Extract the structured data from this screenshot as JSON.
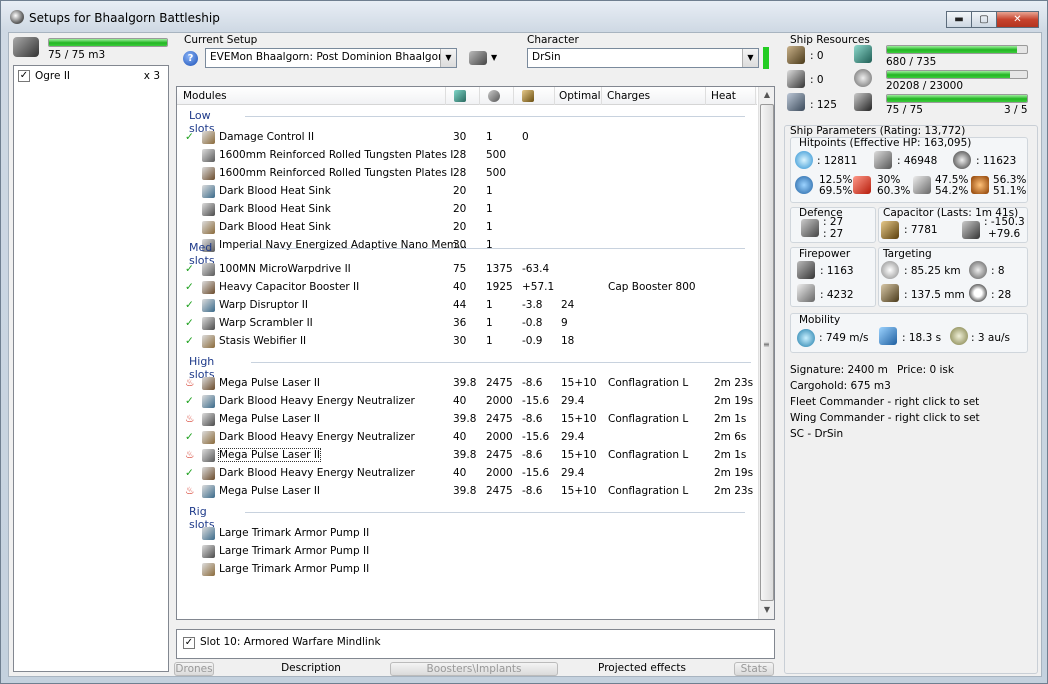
{
  "window": {
    "title": "Setups for Bhaalgorn Battleship"
  },
  "left": {
    "drone_bay": "75 / 75 m3",
    "drone_bay_fraction": 1.0,
    "drones": [
      {
        "name": "Ogre II",
        "count": "x 3",
        "checked": true
      }
    ]
  },
  "setup": {
    "label": "Current Setup",
    "value": "EVEMon Bhaalgorn:  Post Dominion Bhaalgorn"
  },
  "character": {
    "label": "Character",
    "value": "DrSin"
  },
  "modules": {
    "headers": {
      "modules": "Modules",
      "optimal": "Optimal",
      "charges": "Charges",
      "heat": "Heat"
    },
    "low_slots": {
      "title": "Low slots",
      "rows": [
        {
          "check": "✓",
          "name": "Damage Control II",
          "c1": "30",
          "c2": "1",
          "c3": "0",
          "optimal": "",
          "charges": "",
          "heat": ""
        },
        {
          "check": "",
          "name": "1600mm Reinforced Rolled Tungsten Plates I",
          "c1": "28",
          "c2": "500",
          "c3": "",
          "optimal": "",
          "charges": "",
          "heat": ""
        },
        {
          "check": "",
          "name": "1600mm Reinforced Rolled Tungsten Plates I",
          "c1": "28",
          "c2": "500",
          "c3": "",
          "optimal": "",
          "charges": "",
          "heat": ""
        },
        {
          "check": "",
          "name": "Dark Blood Heat Sink",
          "c1": "20",
          "c2": "1",
          "c3": "",
          "optimal": "",
          "charges": "",
          "heat": ""
        },
        {
          "check": "",
          "name": "Dark Blood Heat Sink",
          "c1": "20",
          "c2": "1",
          "c3": "",
          "optimal": "",
          "charges": "",
          "heat": ""
        },
        {
          "check": "",
          "name": "Dark Blood Heat Sink",
          "c1": "20",
          "c2": "1",
          "c3": "",
          "optimal": "",
          "charges": "",
          "heat": ""
        },
        {
          "check": "",
          "name": "Imperial Navy Energized Adaptive Nano Mem...",
          "c1": "30",
          "c2": "1",
          "c3": "",
          "optimal": "",
          "charges": "",
          "heat": ""
        }
      ]
    },
    "med_slots": {
      "title": "Med slots",
      "rows": [
        {
          "check": "✓",
          "name": "100MN MicroWarpdrive II",
          "c1": "75",
          "c2": "1375",
          "c3": "-63.4",
          "optimal": "",
          "charges": "",
          "heat": ""
        },
        {
          "check": "✓",
          "name": "Heavy Capacitor Booster II",
          "c1": "40",
          "c2": "1925",
          "c3": "+57.1",
          "optimal": "",
          "charges": "Cap Booster 800",
          "heat": ""
        },
        {
          "check": "✓",
          "name": "Warp Disruptor II",
          "c1": "44",
          "c2": "1",
          "c3": "-3.8",
          "optimal": "24",
          "charges": "",
          "heat": ""
        },
        {
          "check": "✓",
          "name": "Warp Scrambler II",
          "c1": "36",
          "c2": "1",
          "c3": "-0.8",
          "optimal": "9",
          "charges": "",
          "heat": ""
        },
        {
          "check": "✓",
          "name": "Stasis Webifier II",
          "c1": "30",
          "c2": "1",
          "c3": "-0.9",
          "optimal": "18",
          "charges": "",
          "heat": ""
        }
      ]
    },
    "high_slots": {
      "title": "High slots",
      "rows": [
        {
          "check": "heat",
          "name": "Mega Pulse Laser II",
          "c1": "39.8",
          "c2": "2475",
          "c3": "-8.6",
          "optimal": "15+10",
          "charges": "Conflagration L",
          "heat": "2m 23s"
        },
        {
          "check": "✓",
          "name": "Dark Blood Heavy Energy Neutralizer",
          "c1": "40",
          "c2": "2000",
          "c3": "-15.6",
          "optimal": "29.4",
          "charges": "",
          "heat": "2m 19s"
        },
        {
          "check": "heat",
          "name": "Mega Pulse Laser II",
          "c1": "39.8",
          "c2": "2475",
          "c3": "-8.6",
          "optimal": "15+10",
          "charges": "Conflagration L",
          "heat": "2m 1s"
        },
        {
          "check": "✓",
          "name": "Dark Blood Heavy Energy Neutralizer",
          "c1": "40",
          "c2": "2000",
          "c3": "-15.6",
          "optimal": "29.4",
          "charges": "",
          "heat": "2m 6s"
        },
        {
          "check": "heat",
          "name": "Mega Pulse Laser II",
          "c1": "39.8",
          "c2": "2475",
          "c3": "-8.6",
          "optimal": "15+10",
          "charges": "Conflagration L",
          "heat": "2m 1s"
        },
        {
          "check": "✓",
          "name": "Dark Blood Heavy Energy Neutralizer",
          "c1": "40",
          "c2": "2000",
          "c3": "-15.6",
          "optimal": "29.4",
          "charges": "",
          "heat": "2m 19s"
        },
        {
          "check": "heat",
          "name": "Mega Pulse Laser II",
          "c1": "39.8",
          "c2": "2475",
          "c3": "-8.6",
          "optimal": "15+10",
          "charges": "Conflagration L",
          "heat": "2m 23s"
        }
      ]
    },
    "rig_slots": {
      "title": "Rig slots",
      "rows": [
        {
          "check": "",
          "name": "Large Trimark Armor Pump II",
          "c1": "",
          "c2": "",
          "c3": "",
          "optimal": "",
          "charges": "",
          "heat": ""
        },
        {
          "check": "",
          "name": "Large Trimark Armor Pump II",
          "c1": "",
          "c2": "",
          "c3": "",
          "optimal": "",
          "charges": "",
          "heat": ""
        },
        {
          "check": "",
          "name": "Large Trimark Armor Pump II",
          "c1": "",
          "c2": "",
          "c3": "",
          "optimal": "",
          "charges": "",
          "heat": ""
        }
      ]
    }
  },
  "implant": {
    "label": "Slot 10: Armored Warfare Mindlink",
    "checked": true
  },
  "tabs": [
    "Drones",
    "Description",
    "Boosters\\Implants",
    "Projected effects",
    "Stats"
  ],
  "resources": {
    "label": "Ship Resources",
    "turret": ": 0",
    "launcher": ": 0",
    "calibration": ": 125",
    "cpu": "680 / 735",
    "cpu_fraction": 0.925,
    "powergrid": "20208 / 23000",
    "powergrid_fraction": 0.879,
    "drone_bandwidth": "75 / 75",
    "drone_bandwidth_fraction": 1.0,
    "drone_count": "3 / 5"
  },
  "params": {
    "label": "Ship Parameters (Rating: 13,772)",
    "hitpoints_label": "Hitpoints (Effective HP: 163,095)",
    "shield_hp": ": 12811",
    "armor_hp": ": 46948",
    "structure_hp": ": 11623",
    "resists": [
      [
        "12.5%",
        "69.5%"
      ],
      [
        "30%",
        "60.3%"
      ],
      [
        "47.5%",
        "54.2%"
      ],
      [
        "56.3%",
        "51.1%"
      ]
    ],
    "defence_label": "Defence",
    "defence_a": ": 27",
    "defence_b": ": 27",
    "capacitor_label": "Capacitor (Lasts: 1m 41s)",
    "capacitor": ": 7781",
    "cap_delta_a": ": -150.3",
    "cap_delta_b": "+79.6",
    "firepower_label": "Firepower",
    "firepower_a": ": 1163",
    "firepower_b": ": 4232",
    "targeting_label": "Targeting",
    "target_range": ": 85.25 km",
    "target_count": ": 8",
    "scan_res": ": 137.5 mm",
    "sensor_str": ": 28",
    "mobility_label": "Mobility",
    "speed": ": 749 m/s",
    "align": ": 18.3 s",
    "warp": ": 3 au/s",
    "signature": "Signature: 2400 m",
    "price": "Price: 0 isk",
    "cargohold": "Cargohold: 675 m3",
    "fleet_commander": "Fleet Commander - right click to set",
    "wing_commander": "Wing Commander - right click to set",
    "sc": "SC - DrSin"
  }
}
